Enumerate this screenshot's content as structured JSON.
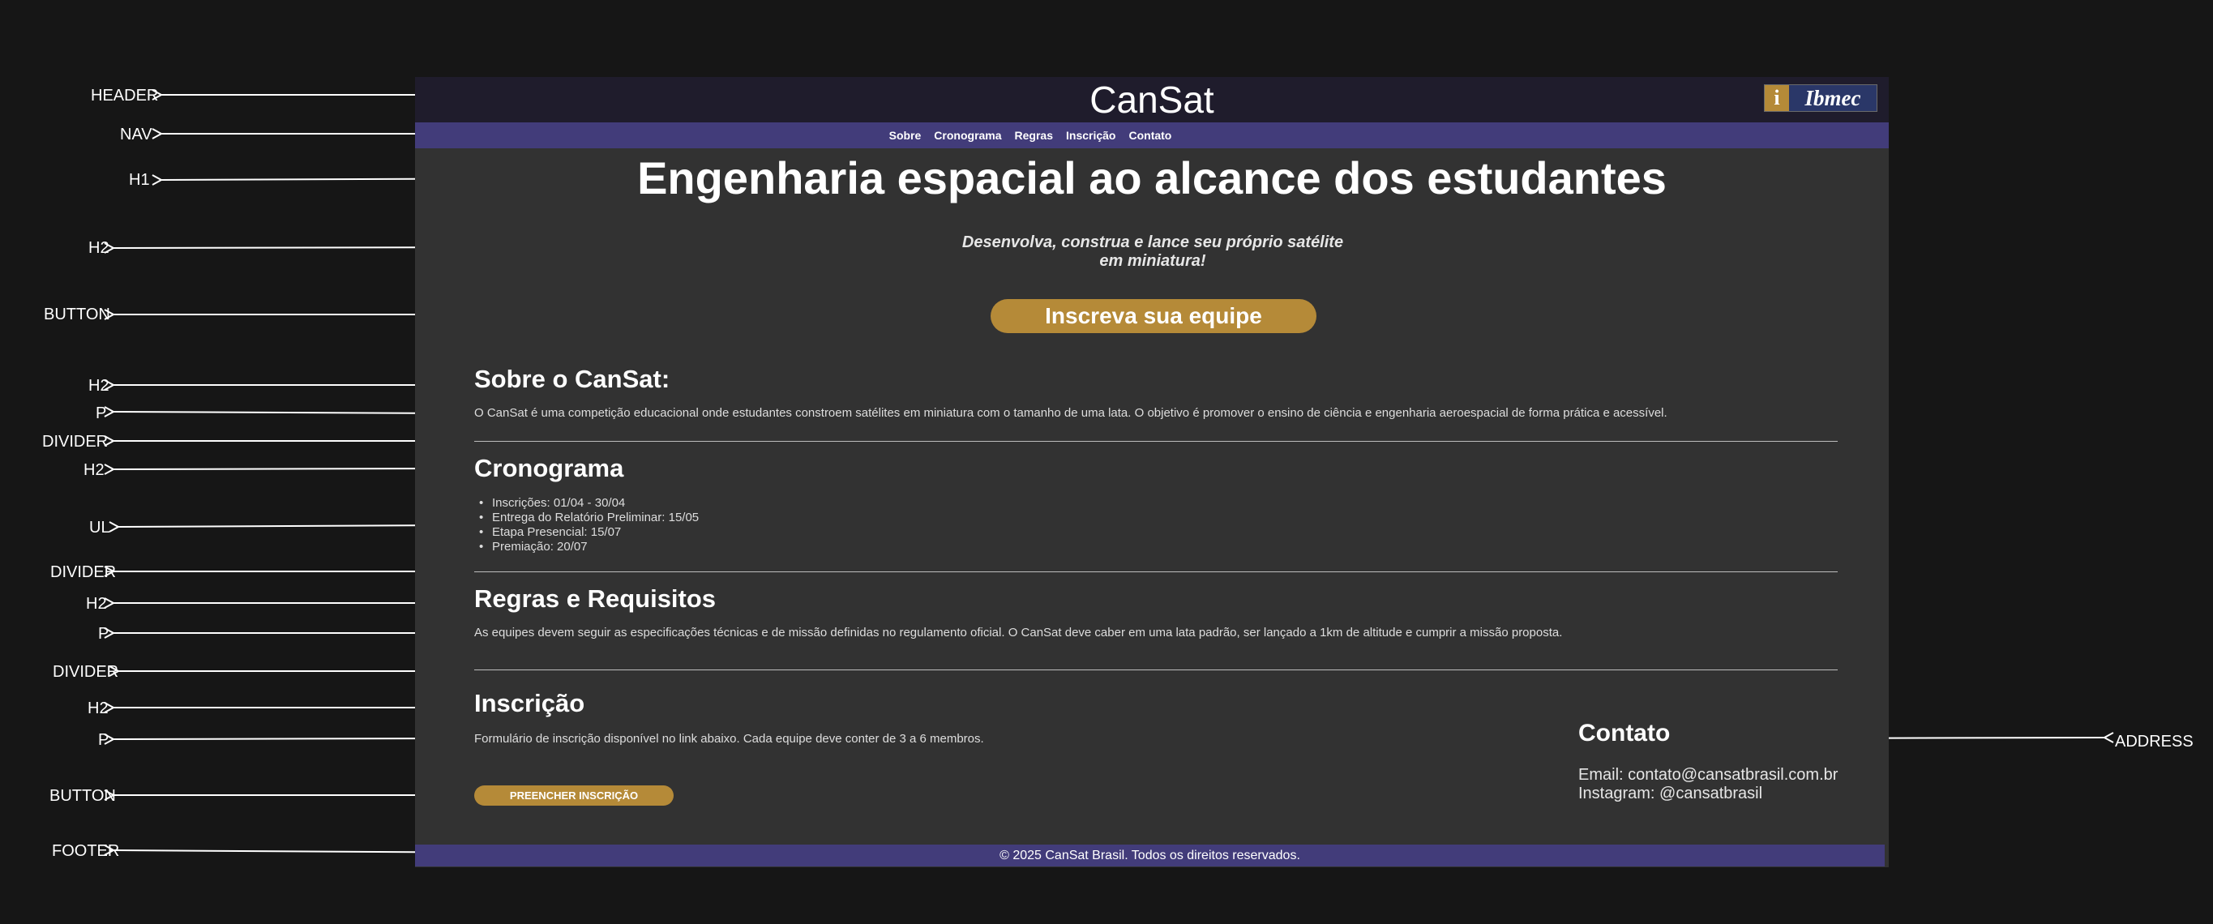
{
  "annotations": {
    "header": "HEADER",
    "nav": "NAV",
    "h1": "H1",
    "h2_hero": "H2",
    "button_hero": "BUTTON",
    "h2_sobre": "H2",
    "p_sobre": "P",
    "divider_1": "DIVIDER",
    "h2_cronograma": "H2",
    "ul": "UL",
    "divider_2": "DIVIDER",
    "h2_regras": "H2",
    "p_regras": "P",
    "divider_3": "DIVIDER",
    "h2_inscricao": "H2",
    "p_inscricao": "P",
    "button_inscricao": "BUTTON",
    "footer": "FOOTER",
    "address": "ADDRESS"
  },
  "header": {
    "title": "CanSat",
    "logo_glyph": "i",
    "logo_text": "Ibmec"
  },
  "nav": {
    "items": [
      "Sobre",
      "Cronograma",
      "Regras",
      "Inscrição",
      "Contato"
    ]
  },
  "hero": {
    "title": "Engenharia espacial ao alcance dos estudantes",
    "subtitle": "Desenvolva, construa e lance seu próprio satélite em miniatura!",
    "cta_label": "Inscreva sua equipe"
  },
  "sections": {
    "sobre": {
      "title": "Sobre o CanSat:",
      "text": "O CanSat é uma competição educacional onde estudantes constroem satélites em miniatura com o tamanho de uma lata. O objetivo é promover o ensino de ciência e engenharia aeroespacial de forma prática e acessível."
    },
    "cronograma": {
      "title": "Cronograma",
      "items": [
        "Inscrições: 01/04 - 30/04",
        "Entrega do Relatório Preliminar: 15/05",
        "Etapa Presencial: 15/07",
        "Premiação: 20/07"
      ]
    },
    "regras": {
      "title": "Regras e Requisitos",
      "text": "As equipes devem seguir as especificações técnicas e de missão definidas no regulamento oficial. O CanSat deve caber em uma lata padrão, ser lançado a 1km de altitude e cumprir a missão proposta."
    },
    "inscricao": {
      "title": "Inscrição",
      "text": "Formulário de inscrição disponível no link abaixo. Cada equipe deve conter de 3 a 6 membros.",
      "button_label": "PREENCHER INSCRIÇÃO"
    }
  },
  "contact": {
    "title": "Contato",
    "email": "Email: contato@cansatbrasil.com.br",
    "instagram": "Instagram: @cansatbrasil"
  },
  "footer": {
    "text": "© 2025 CanSat Brasil. Todos os direitos reservados."
  },
  "colors": {
    "background": "#161616",
    "page": "#323232",
    "header": "#1f1c2c",
    "nav": "#423c7a",
    "accent": "#b58a38",
    "logo_bg": "#2a3768"
  }
}
